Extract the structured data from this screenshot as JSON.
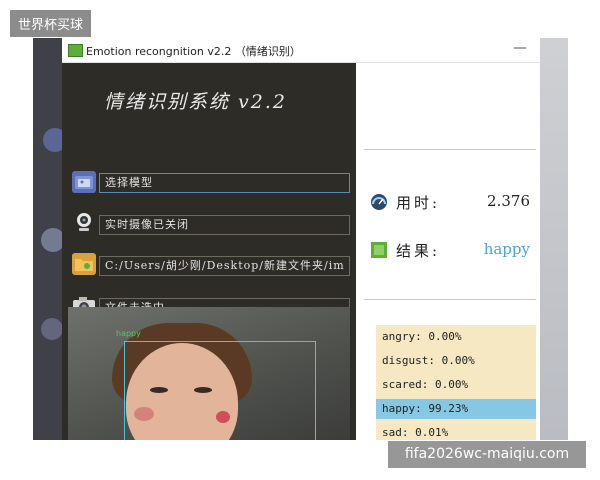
{
  "watermarks": {
    "top_left": "世界杯买球",
    "bottom_right": "fifa2026wc-maiqiu.com"
  },
  "window": {
    "title": "Emotion recongnition v2.2  （情绪识别）",
    "minimize": "—"
  },
  "left_panel": {
    "title": "情绪识别系统  v2.2",
    "rows": [
      {
        "icon": "folder-image-icon",
        "text": "选择模型"
      },
      {
        "icon": "webcam-icon",
        "text": "实时摄像已关闭"
      },
      {
        "icon": "folder-open-icon",
        "text": "C:/Users/胡少刚/Desktop/新建文件夹/im"
      },
      {
        "icon": "camera-icon",
        "text": "文件未选中"
      }
    ],
    "face_box_label": "happy"
  },
  "right_panel": {
    "time_label": "用时:",
    "time_value": "2.376",
    "result_label": "结果:",
    "result_value": "happy",
    "result_color": "#4aa6c8",
    "highlight_color": "#86c7e3",
    "emotions": [
      {
        "label": "angry: 0.00%",
        "value": 0.0
      },
      {
        "label": "disgust: 0.00%",
        "value": 0.0
      },
      {
        "label": "scared: 0.00%",
        "value": 0.0
      },
      {
        "label": "happy: 99.23%",
        "value": 99.23,
        "highlight": true
      },
      {
        "label": "sad: 0.01%",
        "value": 0.01
      }
    ]
  }
}
